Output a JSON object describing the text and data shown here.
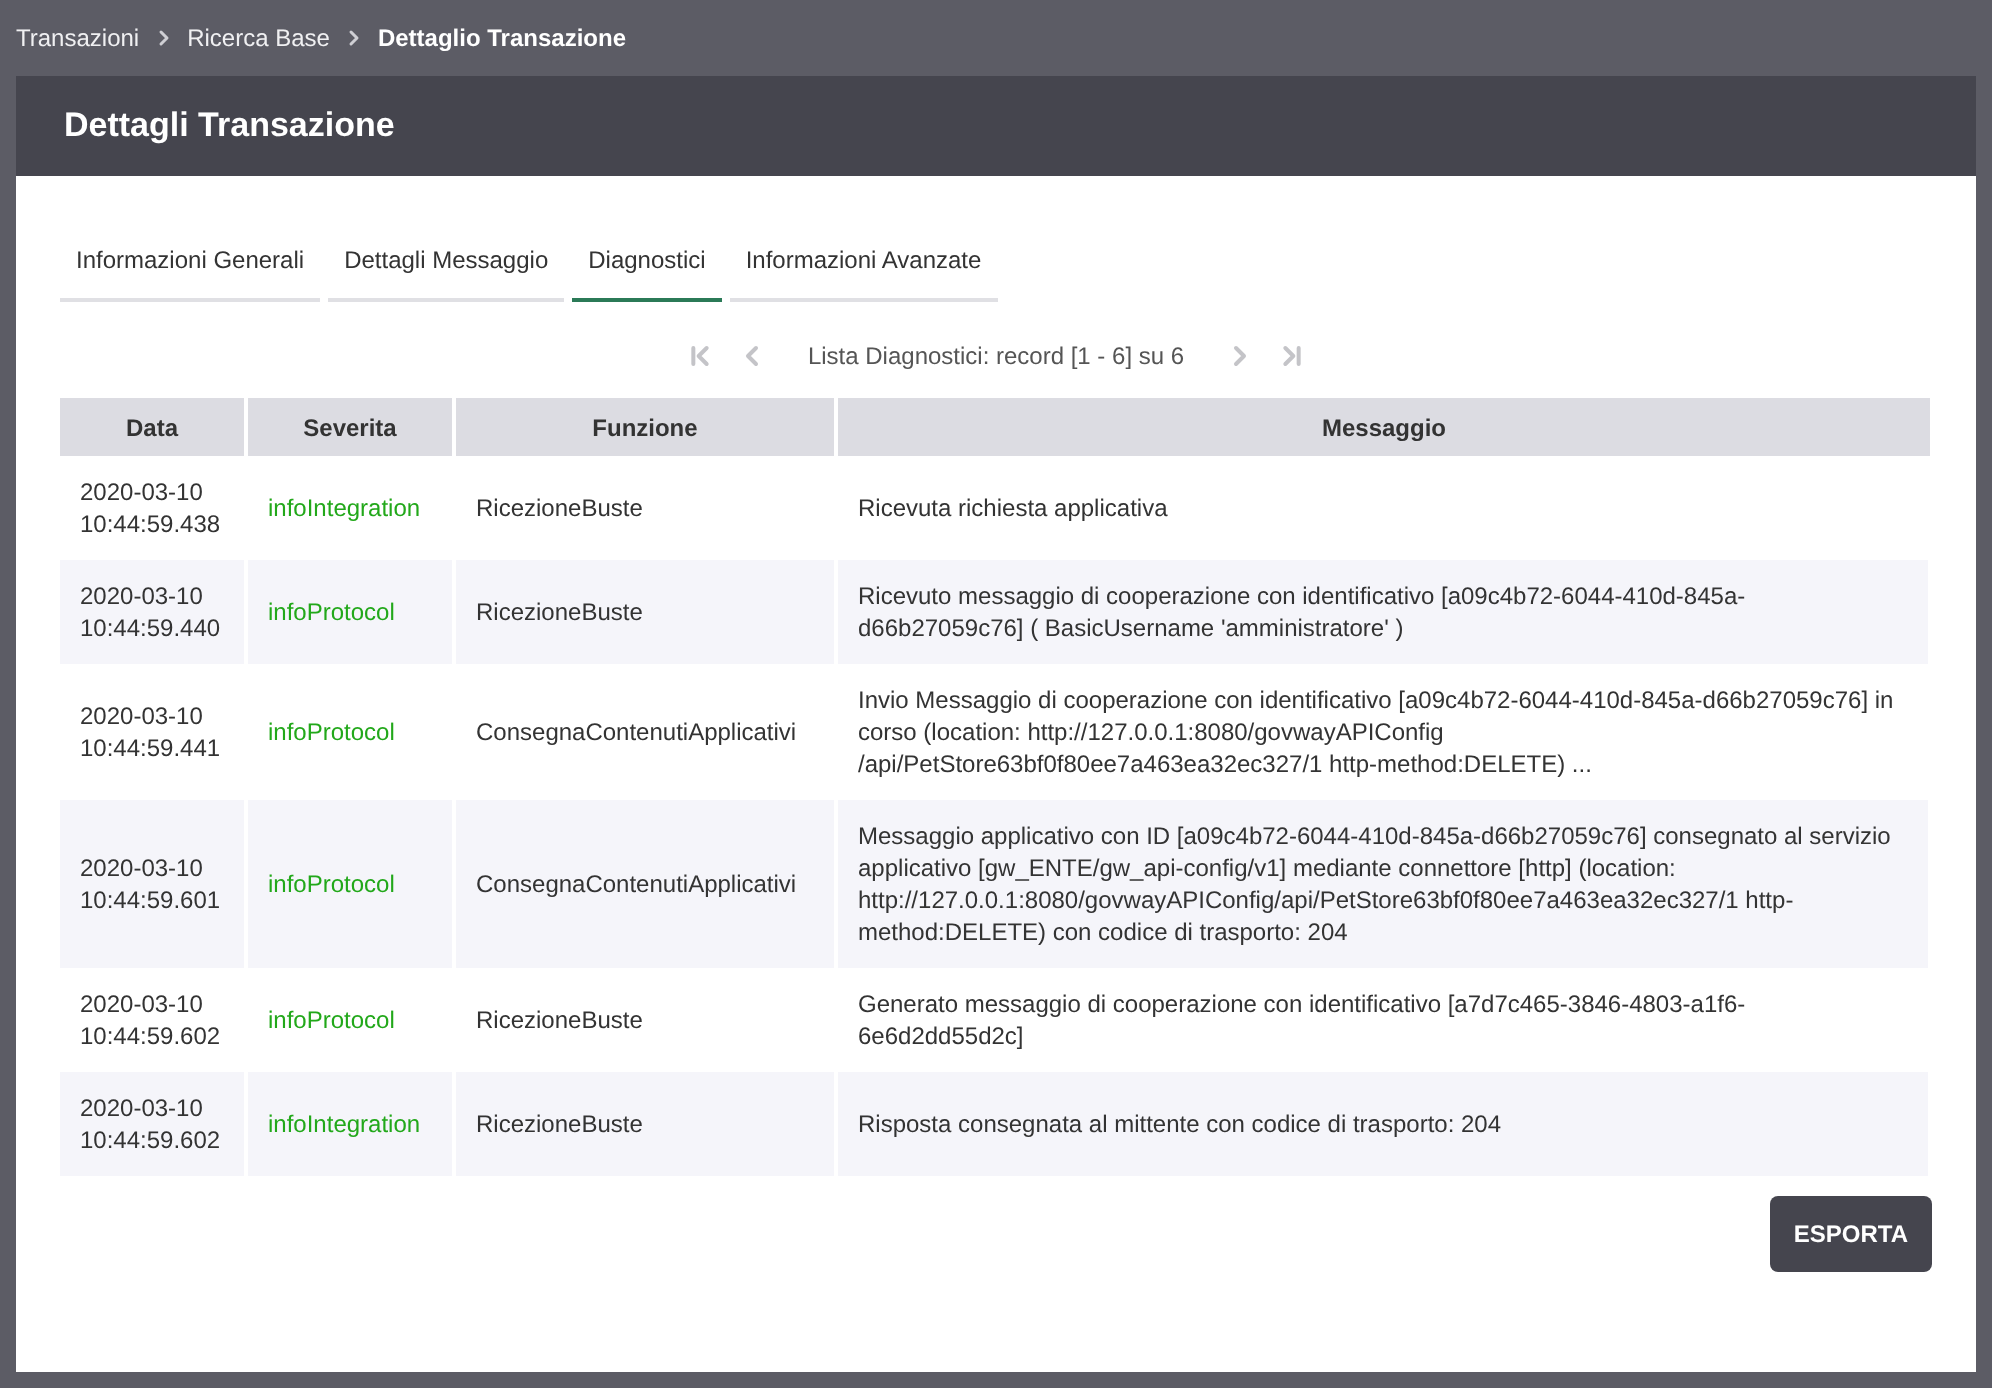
{
  "breadcrumb": [
    {
      "label": "Transazioni",
      "current": false
    },
    {
      "label": "Ricerca Base",
      "current": false
    },
    {
      "label": "Dettaglio Transazione",
      "current": true
    }
  ],
  "panel": {
    "title": "Dettagli Transazione"
  },
  "tabs": [
    {
      "label": "Informazioni Generali",
      "selected": false
    },
    {
      "label": "Dettagli Messaggio",
      "selected": false
    },
    {
      "label": "Diagnostici",
      "selected": true
    },
    {
      "label": "Informazioni Avanzate",
      "selected": false
    }
  ],
  "pager": {
    "text": "Lista Diagnostici: record [1 - 6] su 6",
    "buttons": [
      {
        "kind": "first",
        "disabled": true
      },
      {
        "kind": "prev",
        "disabled": true
      },
      {
        "kind": "next",
        "disabled": true
      },
      {
        "kind": "last",
        "disabled": true
      }
    ]
  },
  "table": {
    "columns": [
      "Data",
      "Severita",
      "Funzione",
      "Messaggio"
    ],
    "rows": [
      {
        "date": "2020-03-10",
        "time": "10:44:59.438",
        "severity": "infoIntegration",
        "function": "RicezioneBuste",
        "message": "Ricevuta richiesta applicativa"
      },
      {
        "date": "2020-03-10",
        "time": "10:44:59.440",
        "severity": "infoProtocol",
        "function": "RicezioneBuste",
        "message": "Ricevuto messaggio di cooperazione con identificativo [a09c4b72-6044-410d-845a-d66b27059c76] ( BasicUsername 'amministratore' )"
      },
      {
        "date": "2020-03-10",
        "time": "10:44:59.441",
        "severity": "infoProtocol",
        "function": "ConsegnaContenutiApplicativi",
        "message": "Invio Messaggio di cooperazione con identificativo [a09c4b72-6044-410d-845a-d66b27059c76] in corso (location: http://127.0.0.1:8080/govwayAPIConfig /api/PetStore63bf0f80ee7a463ea32ec327/1 http-method:DELETE) ..."
      },
      {
        "date": "2020-03-10",
        "time": "10:44:59.601",
        "severity": "infoProtocol",
        "function": "ConsegnaContenutiApplicativi",
        "message": "Messaggio applicativo con ID [a09c4b72-6044-410d-845a-d66b27059c76] consegnato al servizio applicativo [gw_ENTE/gw_api-config/v1] mediante connettore [http] (location: http://127.0.0.1:8080/govwayAPIConfig/api/PetStore63bf0f80ee7a463ea32ec327/1 http-method:DELETE) con codice di trasporto: 204"
      },
      {
        "date": "2020-03-10",
        "time": "10:44:59.602",
        "severity": "infoProtocol",
        "function": "RicezioneBuste",
        "message": "Generato messaggio di cooperazione con identificativo [a7d7c465-3846-4803-a1f6-6e6d2dd55d2c]"
      },
      {
        "date": "2020-03-10",
        "time": "10:44:59.602",
        "severity": "infoIntegration",
        "function": "RicezioneBuste",
        "message": "Risposta consegnata al mittente con codice di trasporto: 204"
      }
    ]
  },
  "export_button": "ESPORTA"
}
